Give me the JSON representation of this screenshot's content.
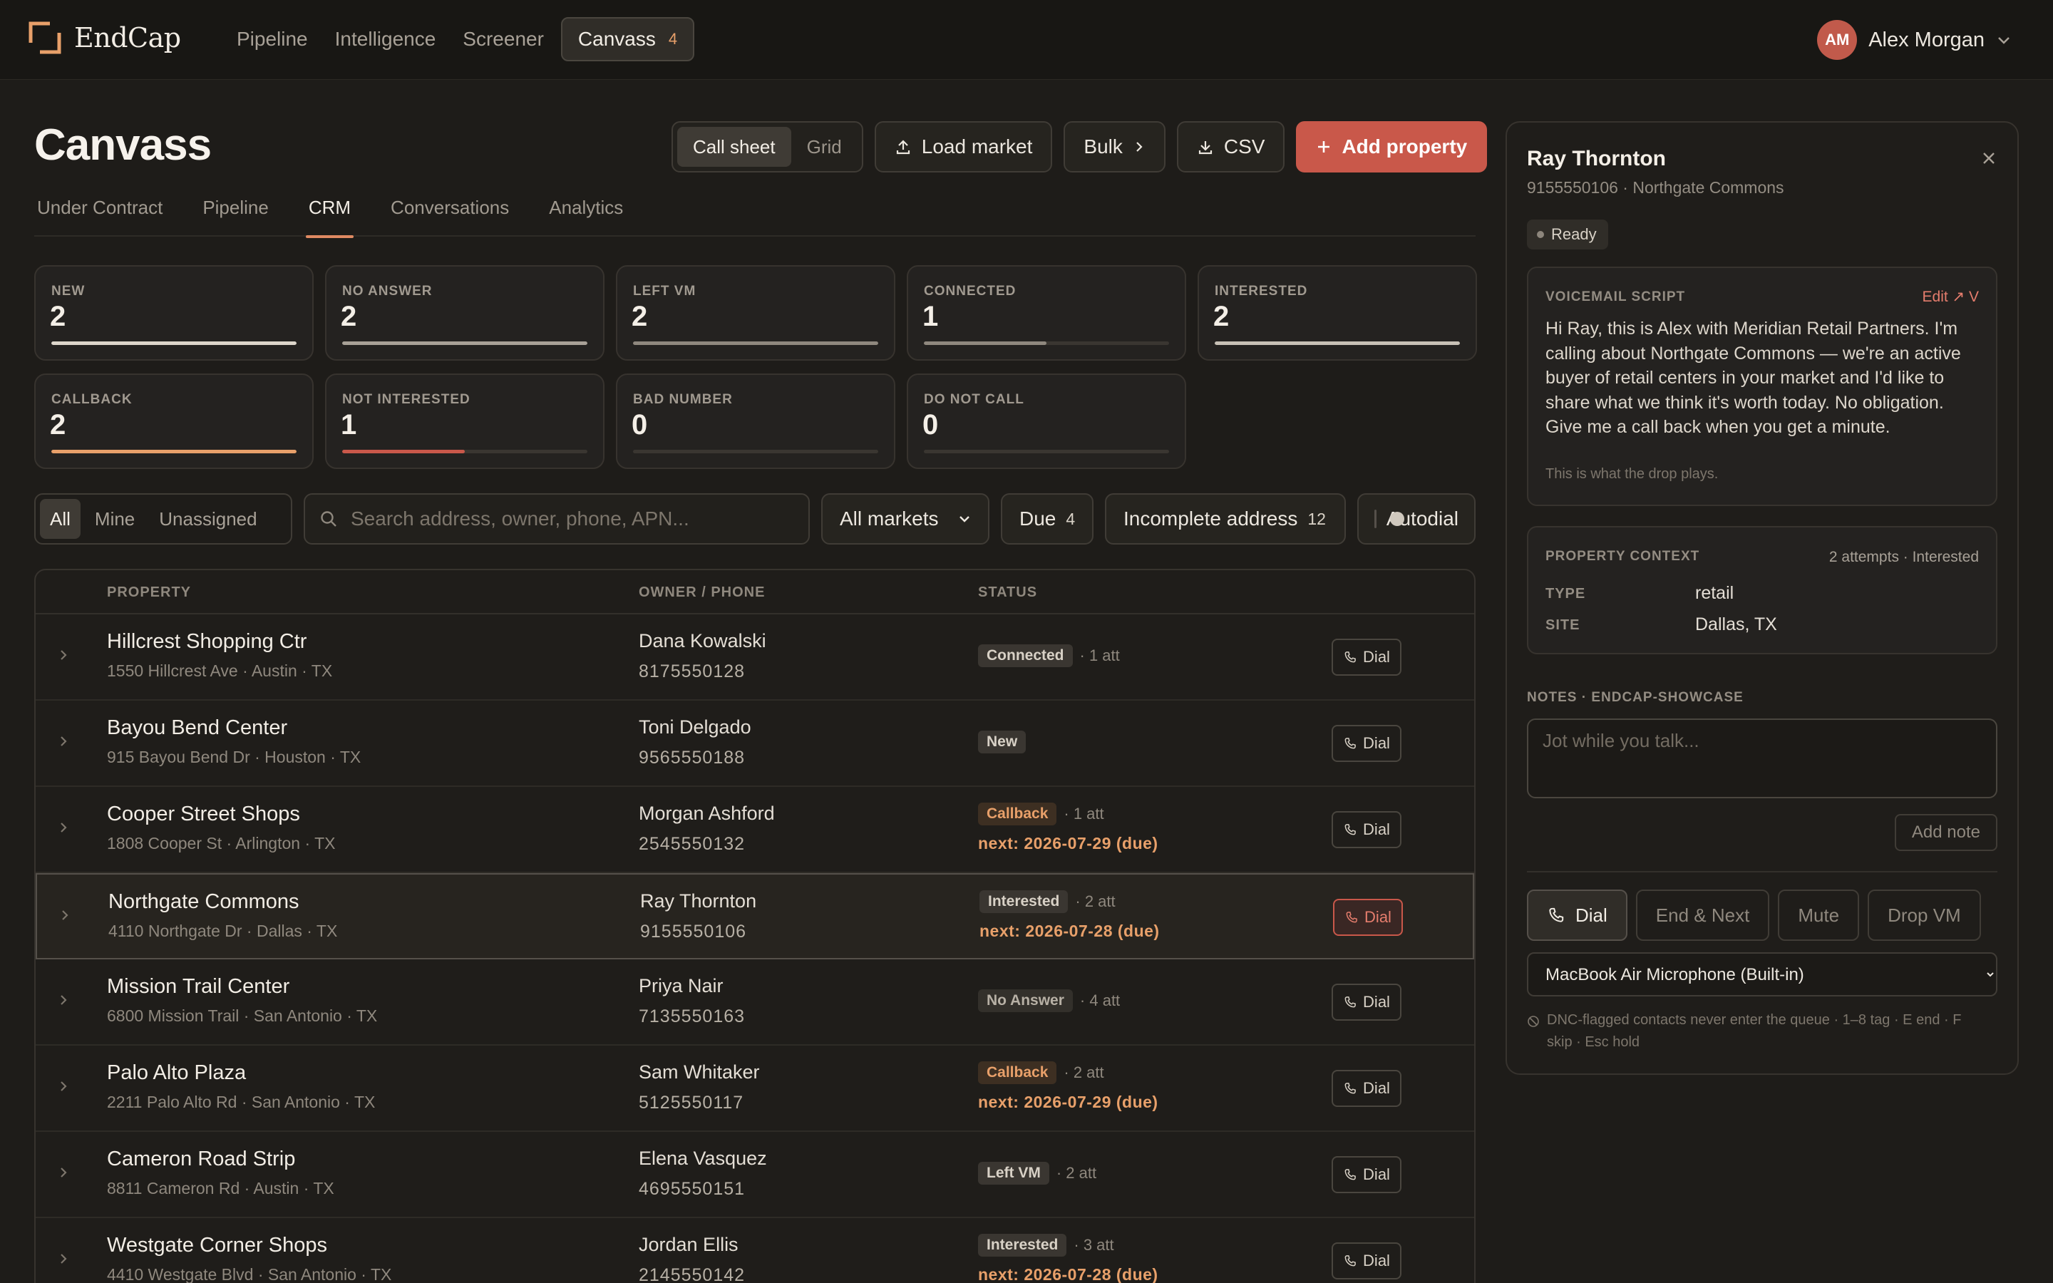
{
  "app": {
    "name": "EndCap"
  },
  "nav": {
    "items": [
      {
        "label": "Pipeline"
      },
      {
        "label": "Intelligence"
      },
      {
        "label": "Screener"
      },
      {
        "label": "Canvass",
        "count": "4",
        "active": true
      }
    ]
  },
  "user": {
    "initials": "AM",
    "name": "Alex Morgan"
  },
  "page": {
    "title": "Canvass"
  },
  "toolbar": {
    "view_call_sheet": "Call sheet",
    "view_grid": "Grid",
    "load_market": "Load market",
    "bulk": "Bulk",
    "csv": "CSV",
    "add_property": "Add property"
  },
  "tabs": [
    {
      "label": "Under Contract"
    },
    {
      "label": "Pipeline"
    },
    {
      "label": "CRM",
      "active": true
    },
    {
      "label": "Conversations"
    },
    {
      "label": "Analytics"
    }
  ],
  "status_cards": [
    {
      "label": "NEW",
      "value": "2",
      "fill": 1.0,
      "color": "#ddd6cb"
    },
    {
      "label": "NO ANSWER",
      "value": "2",
      "fill": 1.0,
      "color": "#a8a197"
    },
    {
      "label": "LEFT VM",
      "value": "2",
      "fill": 1.0,
      "color": "#8f887e"
    },
    {
      "label": "CONNECTED",
      "value": "1",
      "fill": 0.5,
      "color": "#8f887e"
    },
    {
      "label": "INTERESTED",
      "value": "2",
      "fill": 1.0,
      "color": "#c8c1b6"
    },
    {
      "label": "CALLBACK",
      "value": "2",
      "fill": 1.0,
      "color": "#e8a06a"
    },
    {
      "label": "NOT INTERESTED",
      "value": "1",
      "fill": 0.5,
      "color": "#c9584a"
    },
    {
      "label": "BAD NUMBER",
      "value": "0",
      "fill": 0,
      "color": "#8f887e"
    },
    {
      "label": "DO NOT CALL",
      "value": "0",
      "fill": 0,
      "color": "#8f887e"
    }
  ],
  "filters": {
    "scope": [
      "All",
      "Mine",
      "Unassigned"
    ],
    "scope_active": "All",
    "search_placeholder": "Search address, owner, phone, APN...",
    "market": "All markets",
    "due_label": "Due",
    "due_count": "4",
    "incomplete_label": "Incomplete address",
    "incomplete_count": "12",
    "autodial_label": "Autodial"
  },
  "table": {
    "headers": {
      "property": "PROPERTY",
      "owner": "OWNER / PHONE",
      "status": "STATUS"
    },
    "dial_label": "Dial",
    "rows": [
      {
        "name": "Hillcrest Shopping Ctr",
        "address": "1550 Hillcrest Ave · Austin · TX",
        "owner": "Dana Kowalski",
        "phone": "8175550128",
        "status": "Connected",
        "status_color": "#d8d1c6",
        "badge_bg": "#3a3631",
        "attempts": "· 1 att",
        "next": ""
      },
      {
        "name": "Bayou Bend Center",
        "address": "915 Bayou Bend Dr · Houston · TX",
        "owner": "Toni Delgado",
        "phone": "9565550188",
        "status": "New",
        "status_color": "#d8d1c6",
        "badge_bg": "#3a3631",
        "attempts": "",
        "next": ""
      },
      {
        "name": "Cooper Street Shops",
        "address": "1808 Cooper St · Arlington · TX",
        "owner": "Morgan Ashford",
        "phone": "2545550132",
        "status": "Callback",
        "status_color": "#e8a06a",
        "badge_bg": "#3d2f22",
        "attempts": "· 1 att",
        "next": "next: 2026-07-29 (due)"
      },
      {
        "name": "Northgate Commons",
        "address": "4110 Northgate Dr · Dallas · TX",
        "owner": "Ray Thornton",
        "phone": "9155550106",
        "status": "Interested",
        "status_color": "#d8d1c6",
        "badge_bg": "#3a3631",
        "attempts": "· 2 att",
        "next": "next: 2026-07-28 (due)",
        "selected": true
      },
      {
        "name": "Mission Trail Center",
        "address": "6800 Mission Trail · San Antonio · TX",
        "owner": "Priya Nair",
        "phone": "7135550163",
        "status": "No Answer",
        "status_color": "#b7b0a5",
        "badge_bg": "#33302b",
        "attempts": "· 4 att",
        "next": ""
      },
      {
        "name": "Palo Alto Plaza",
        "address": "2211 Palo Alto Rd · San Antonio · TX",
        "owner": "Sam Whitaker",
        "phone": "5125550117",
        "status": "Callback",
        "status_color": "#e8a06a",
        "badge_bg": "#3d2f22",
        "attempts": "· 2 att",
        "next": "next: 2026-07-29 (due)"
      },
      {
        "name": "Cameron Road Strip",
        "address": "8811 Cameron Rd · Austin · TX",
        "owner": "Elena Vasquez",
        "phone": "4695550151",
        "status": "Left VM",
        "status_color": "#d8d1c6",
        "badge_bg": "#3a3631",
        "attempts": "· 2 att",
        "next": ""
      },
      {
        "name": "Westgate Corner Shops",
        "address": "4410 Westgate Blvd · San Antonio · TX",
        "owner": "Jordan Ellis",
        "phone": "2145550142",
        "status": "Interested",
        "status_color": "#d8d1c6",
        "badge_bg": "#3a3631",
        "attempts": "· 3 att",
        "next": "next: 2026-07-28 (due)"
      }
    ]
  },
  "panel": {
    "name": "Ray Thornton",
    "subtitle": "9155550106 · Northgate Commons",
    "state": "Ready",
    "vm_label": "VOICEMAIL SCRIPT",
    "vm_edit": "Edit ↗ V",
    "vm_script": "Hi Ray, this is Alex with Meridian Retail Partners. I'm calling about Northgate Commons — we're an active buyer of retail centers in your market and I'd like to share what we think it's worth today. No obligation. Give me a call back when you get a minute.",
    "vm_footnote": "This is what the drop plays.",
    "context_label": "PROPERTY CONTEXT",
    "context_summary": "2 attempts · Interested",
    "type_key": "TYPE",
    "type_value": "retail",
    "site_key": "SITE",
    "site_value": "Dallas, TX",
    "notes_label": "NOTES · ENDCAP-SHOWCASE",
    "notes_placeholder": "Jot while you talk...",
    "add_note": "Add note",
    "dial": "Dial",
    "end_next": "End & Next",
    "mute": "Mute",
    "drop_vm": "Drop VM",
    "microphone": "MacBook Air Microphone (Built-in)",
    "help": "DNC-flagged contacts never enter the queue · 1–8 tag · E end · F skip · Esc hold"
  },
  "colors": {
    "accent": "#c9584a",
    "callback": "#e8a06a",
    "background": "#1e1c19"
  }
}
